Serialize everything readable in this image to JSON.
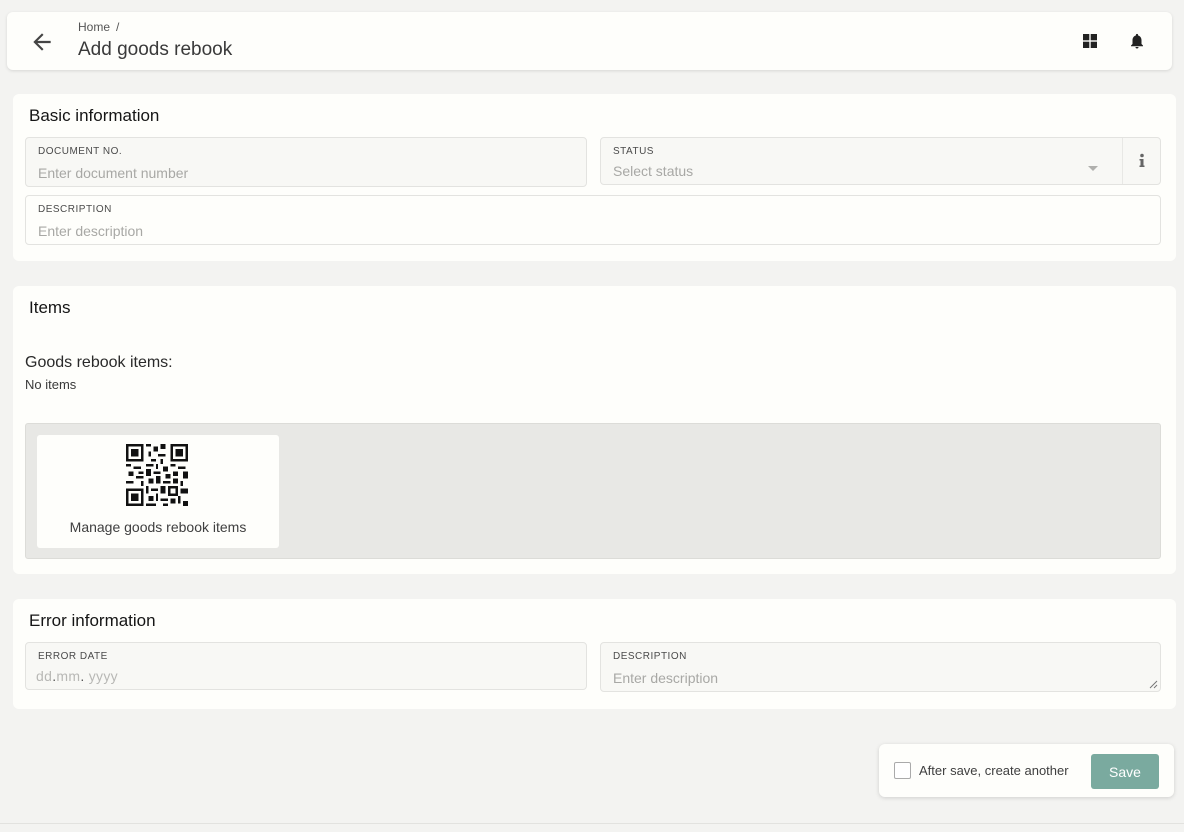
{
  "header": {
    "breadcrumb_home": "Home",
    "breadcrumb_sep": "/",
    "title": "Add goods rebook"
  },
  "basic": {
    "title": "Basic information",
    "document_no": {
      "label": "DOCUMENT NO.",
      "placeholder": "Enter document number"
    },
    "status": {
      "label": "STATUS",
      "placeholder": "Select status"
    },
    "description": {
      "label": "DESCRIPTION",
      "placeholder": "Enter description"
    }
  },
  "items": {
    "title": "Items",
    "subtitle": "Goods rebook items:",
    "empty_text": "No items",
    "manage_label": "Manage goods rebook items"
  },
  "error": {
    "title": "Error information",
    "error_date": {
      "label": "ERROR DATE",
      "dd": "dd",
      "mm": "mm",
      "yyyy": "yyyy"
    },
    "description": {
      "label": "DESCRIPTION",
      "placeholder": "Enter description"
    }
  },
  "footer": {
    "create_another_label": "After save, create another",
    "save_label": "Save"
  },
  "colors": {
    "accent": "#7aaa9f",
    "background": "#f3f3f1",
    "card": "#fefefb"
  },
  "icons": [
    "arrow-left-icon",
    "grid-icon",
    "bell-icon",
    "info-icon",
    "qr-code-icon",
    "resize-grip-icon"
  ]
}
